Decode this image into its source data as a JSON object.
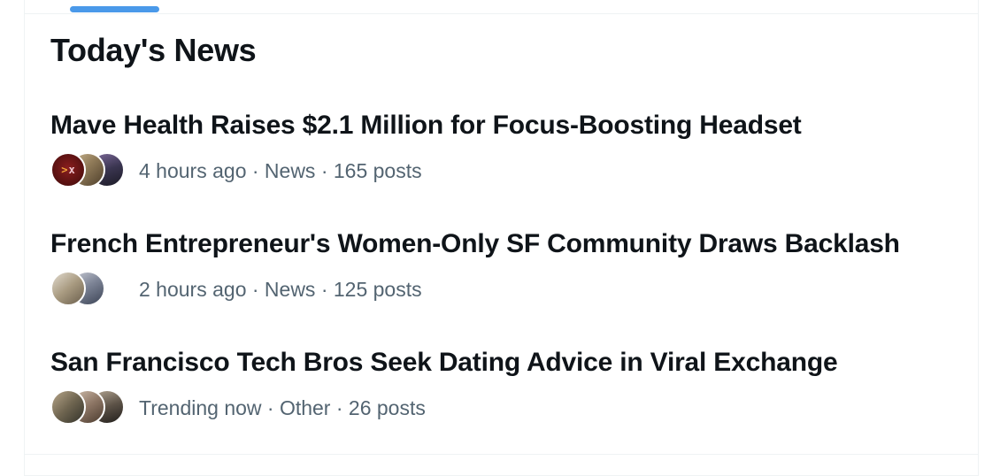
{
  "section": {
    "title": "Today's News"
  },
  "news": [
    {
      "headline": "Mave Health Raises $2.1 Million for Focus-Boosting Headset",
      "meta": "4 hours ago · News · 165 posts",
      "avatars": [
        {
          "name": "avatar-logo",
          "colors": [
            "#5a1010",
            "#8a1e1e"
          ],
          "logo": true
        },
        {
          "name": "avatar-photo",
          "colors": [
            "#6f5a3e",
            "#c9b48f"
          ]
        },
        {
          "name": "avatar-photo",
          "colors": [
            "#2b2a3e",
            "#7d6a9a"
          ]
        }
      ]
    },
    {
      "headline": "French Entrepreneur's Women-Only SF Community Draws Backlash",
      "meta": "2 hours ago · News · 125 posts",
      "avatars": [
        {
          "name": "avatar-photo",
          "colors": [
            "#8a7c66",
            "#d8cfc0"
          ]
        },
        {
          "name": "avatar-photo",
          "colors": [
            "#4a5264",
            "#b9bcc6"
          ]
        }
      ]
    },
    {
      "headline": "San Francisco Tech Bros Seek Dating Advice in Viral Exchange",
      "meta": "Trending now · Other · 26 posts",
      "avatars": [
        {
          "name": "avatar-photo",
          "colors": [
            "#4b4b3a",
            "#b7a68a"
          ]
        },
        {
          "name": "avatar-photo",
          "colors": [
            "#6e5a4a",
            "#d1bfae"
          ]
        },
        {
          "name": "avatar-photo",
          "colors": [
            "#2e2a26",
            "#a89a88"
          ]
        }
      ]
    }
  ],
  "logo_text": {
    "chevron": ">",
    "letter": "x"
  }
}
